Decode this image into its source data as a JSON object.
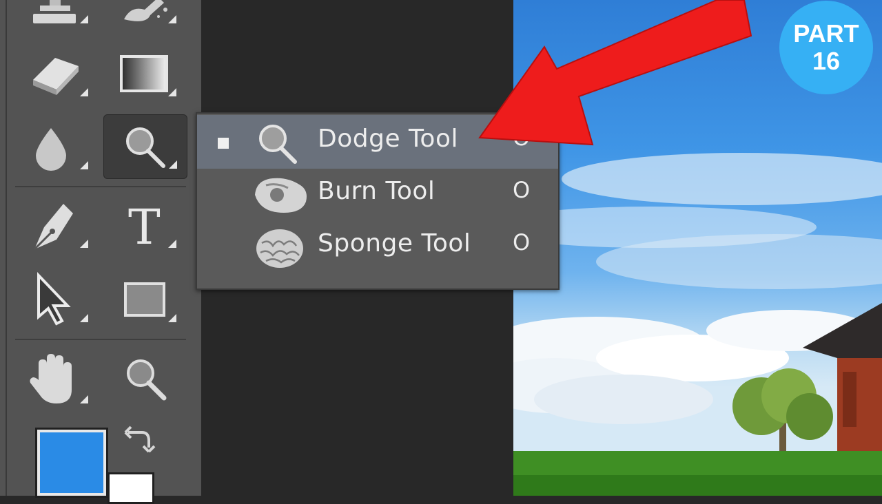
{
  "toolbar": {
    "tools": [
      {
        "name": "stamp",
        "icon": "clone-stamp-icon"
      },
      {
        "name": "brush",
        "icon": "history-brush-icon"
      },
      {
        "name": "eraser",
        "icon": "eraser-icon"
      },
      {
        "name": "gradient",
        "icon": "gradient-icon"
      },
      {
        "name": "blur",
        "icon": "blur-drop-icon"
      },
      {
        "name": "dodge",
        "icon": "dodge-icon",
        "active": true
      },
      {
        "name": "pen",
        "icon": "pen-icon"
      },
      {
        "name": "type",
        "icon": "type-icon",
        "glyph": "T"
      },
      {
        "name": "selection",
        "icon": "path-selection-arrow-icon"
      },
      {
        "name": "shape",
        "icon": "rectangle-shape-icon"
      },
      {
        "name": "hand",
        "icon": "hand-icon"
      },
      {
        "name": "zoom",
        "icon": "zoom-icon"
      }
    ],
    "foreground_color": "#2a8be6",
    "background_color": "#ffffff"
  },
  "flyout_menu": {
    "items": [
      {
        "label": "Dodge Tool",
        "shortcut": "O",
        "icon": "dodge-icon",
        "selected": true
      },
      {
        "label": "Burn Tool",
        "shortcut": "O",
        "icon": "burn-hand-icon",
        "selected": false
      },
      {
        "label": "Sponge Tool",
        "shortcut": "O",
        "icon": "sponge-icon",
        "selected": false
      }
    ]
  },
  "badge": {
    "line1": "PART",
    "line2": "16",
    "color": "#36b0f4"
  },
  "arrow_color": "#ee1c1c"
}
